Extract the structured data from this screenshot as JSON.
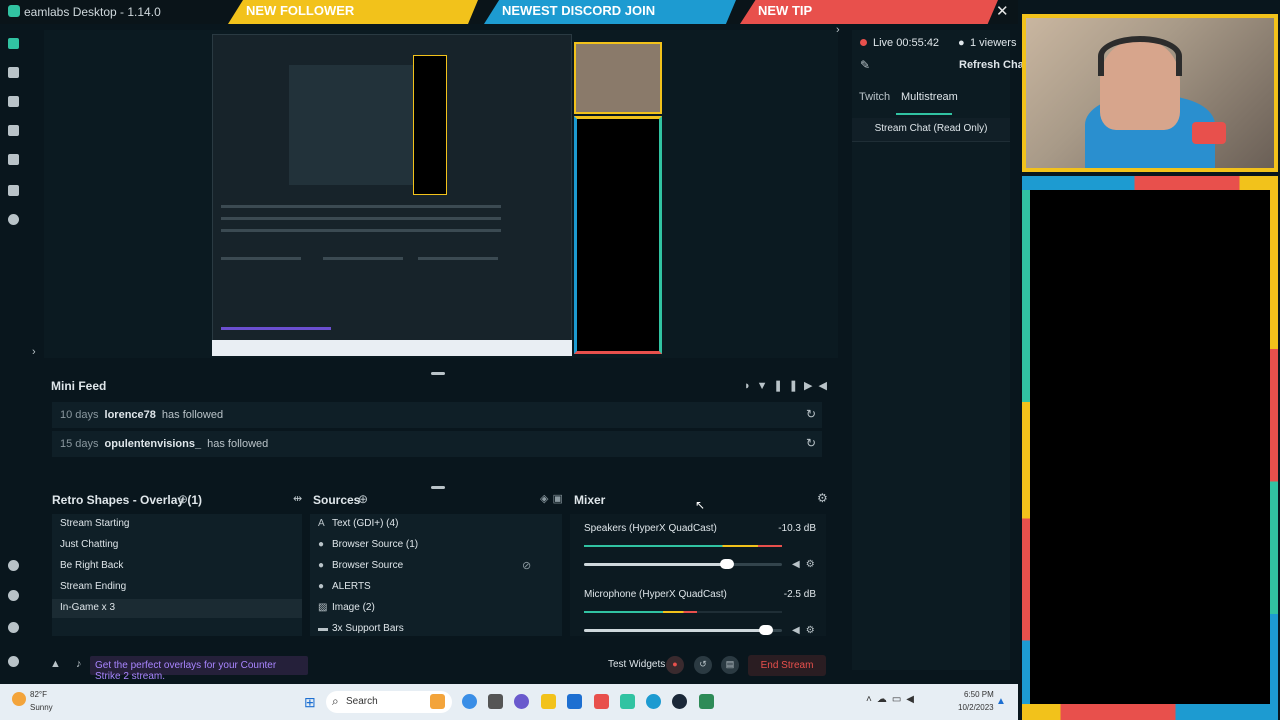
{
  "app": {
    "title": "eamlabs Desktop - 1.14.0"
  },
  "banners": {
    "follower": "NEW FOLLOWER",
    "discord": "NEWEST DISCORD JOIN",
    "tip": "NEW TIP"
  },
  "chat": {
    "live_label": "Live 00:55:42",
    "viewers_label": "1 viewers",
    "refresh_label": "Refresh Chat",
    "tabs": [
      "Twitch",
      "Multistream"
    ],
    "header": "Stream Chat (Read Only)"
  },
  "minifeed": {
    "title": "Mini Feed",
    "rows": [
      {
        "ago": "10 days",
        "user": "lorence78",
        "action": "has followed"
      },
      {
        "ago": "15 days",
        "user": "opulentenvisions_",
        "action": "has followed"
      }
    ]
  },
  "scenes": {
    "title": "Retro Shapes - Overlay (1)",
    "items": [
      "Stream Starting",
      "Just Chatting",
      "Be Right Back",
      "Stream Ending",
      "In-Game x 3"
    ],
    "active_index": 4
  },
  "sources": {
    "title": "Sources",
    "items": [
      {
        "label": "Text (GDI+) (4)",
        "icon": "text-icon"
      },
      {
        "label": "Browser Source (1)",
        "icon": "globe-icon"
      },
      {
        "label": "Browser Source",
        "icon": "globe-icon"
      },
      {
        "label": "ALERTS",
        "icon": "globe-icon"
      },
      {
        "label": "Image (2)",
        "icon": "image-icon"
      },
      {
        "label": "3x Support Bars",
        "icon": "folder-icon"
      }
    ]
  },
  "mixer": {
    "title": "Mixer",
    "channels": [
      {
        "name": "Speakers (HyperX QuadCast)",
        "db": "-10.3 dB",
        "level": 0.72,
        "meter": 1.0
      },
      {
        "name": "Microphone (HyperX QuadCast)",
        "db": "-2.5 dB",
        "level": 0.92,
        "meter": 0.57
      }
    ]
  },
  "bottombar": {
    "promo": "Get the perfect overlays for your Counter Strike 2 stream.",
    "test_widgets": "Test Widgets",
    "end_stream": "End Stream"
  },
  "taskbar": {
    "weather_temp": "82°F",
    "weather_cond": "Sunny",
    "search_label": "Search",
    "time": "6:50 PM",
    "date": "10/2/2023"
  },
  "colors": {
    "yellow": "#f2c21b",
    "blue": "#1d9bd1",
    "red": "#e8504c",
    "teal": "#31c3a2"
  }
}
